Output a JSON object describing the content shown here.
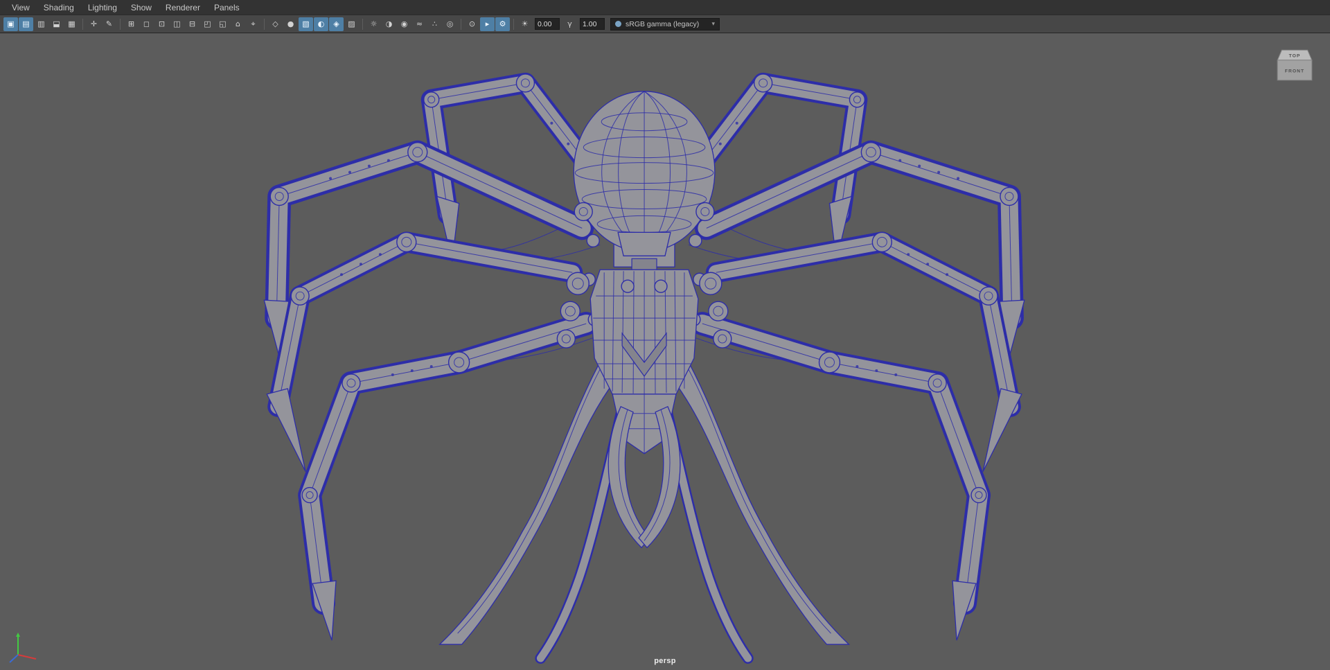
{
  "menubar": {
    "items": [
      "View",
      "Shading",
      "Lighting",
      "Show",
      "Renderer",
      "Panels"
    ]
  },
  "toolbar": {
    "icons": [
      {
        "name": "select-camera",
        "glyph": "▣",
        "active": true
      },
      {
        "name": "lock-camera",
        "glyph": "▤",
        "active": true
      },
      {
        "name": "camera-attributes",
        "glyph": "▥"
      },
      {
        "name": "bookmark",
        "glyph": "⬓"
      },
      {
        "name": "image-plane",
        "glyph": "▦"
      },
      {
        "name": "two-d-pan-zoom",
        "glyph": "✛",
        "sep": true
      },
      {
        "name": "grease-pencil",
        "glyph": "✎"
      },
      {
        "name": "grid",
        "glyph": "⊞",
        "sep": true
      },
      {
        "name": "film-gate",
        "glyph": "◻"
      },
      {
        "name": "resolution-gate",
        "glyph": "⊡"
      },
      {
        "name": "gate-mask",
        "glyph": "◫"
      },
      {
        "name": "field-chart",
        "glyph": "⊟"
      },
      {
        "name": "safe-action",
        "glyph": "◰"
      },
      {
        "name": "safe-title",
        "glyph": "◱"
      },
      {
        "name": "frame-all",
        "glyph": "⌂"
      },
      {
        "name": "frame-selected",
        "glyph": "⌖"
      },
      {
        "name": "wireframe",
        "glyph": "◇",
        "sep": true
      },
      {
        "name": "smooth-shade",
        "glyph": "●"
      },
      {
        "name": "textured",
        "glyph": "▧",
        "active": true
      },
      {
        "name": "use-default-material",
        "glyph": "◐",
        "active": true
      },
      {
        "name": "wireframe-on-shaded",
        "glyph": "◈",
        "active": true
      },
      {
        "name": "xray",
        "glyph": "▨"
      },
      {
        "name": "lighting-all",
        "glyph": "☼",
        "sep": true
      },
      {
        "name": "shadows",
        "glyph": "◑"
      },
      {
        "name": "ambient-occlusion",
        "glyph": "◉"
      },
      {
        "name": "motion-blur",
        "glyph": "≈"
      },
      {
        "name": "anti-aliasing",
        "glyph": "∴"
      },
      {
        "name": "depth-of-field",
        "glyph": "◎"
      },
      {
        "name": "isolate-select",
        "glyph": "⊙",
        "sep": true
      },
      {
        "name": "viewport-renderer",
        "glyph": "▸",
        "active": true
      },
      {
        "name": "render-settings",
        "glyph": "⚙",
        "active": true
      }
    ],
    "exposure": {
      "icon": "☀",
      "value": "0.00"
    },
    "gamma": {
      "icon": "γ",
      "value": "1.00"
    },
    "view_transform": {
      "value": "sRGB gamma (legacy)",
      "caret": "▾"
    }
  },
  "viewport": {
    "camera_label": "persp",
    "viewcube": {
      "top": "TOP",
      "front": "FRONT"
    },
    "colors": {
      "background": "#5c5c5c",
      "wireframe": "#2d2da8",
      "model_fill": "#94949b",
      "axis_x": "#d63b3b",
      "axis_y": "#43c943",
      "axis_z": "#3b6bd6"
    }
  }
}
